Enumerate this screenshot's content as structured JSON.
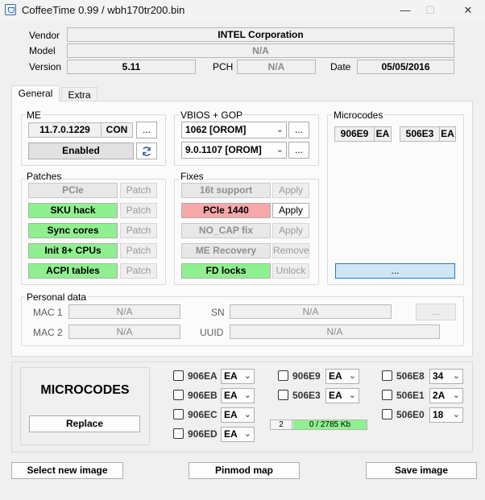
{
  "window": {
    "title": "CoffeeTime 0.99  /  wbh170tr200.bin",
    "minimize_glyph": "—",
    "maximize_glyph": "☐",
    "close_glyph": "✕"
  },
  "info": {
    "vendor_label": "Vendor",
    "vendor_value": "INTEL Corporation",
    "model_label": "Model",
    "model_value": "N/A",
    "version_label": "Version",
    "version_value": "5.11",
    "pch_label": "PCH",
    "pch_value": "N/A",
    "date_label": "Date",
    "date_value": "05/05/2016"
  },
  "tabs": [
    {
      "label": "General"
    },
    {
      "label": "Extra"
    }
  ],
  "me": {
    "title": "ME",
    "version": "11.7.0.1229",
    "type": "CON",
    "more": "...",
    "state": "Enabled",
    "refresh_icon": "refresh-icon"
  },
  "vbios": {
    "title": "VBIOS + GOP",
    "vbios_value": "1062 [OROM]",
    "gop_value": "9.0.1107 [OROM]",
    "more": "..."
  },
  "microcodes_panel": {
    "title": "Microcodes",
    "items": [
      {
        "cpuid": "906E9",
        "tag": "EA"
      },
      {
        "cpuid": "506E3",
        "tag": "EA"
      }
    ],
    "more": "..."
  },
  "patches": {
    "title": "Patches",
    "items": [
      {
        "label": "PCIe",
        "action": "Patch",
        "state": "off"
      },
      {
        "label": "SKU hack",
        "action": "Patch",
        "state": "green"
      },
      {
        "label": "Sync cores",
        "action": "Patch",
        "state": "green"
      },
      {
        "label": "Init 8+ CPUs",
        "action": "Patch",
        "state": "green"
      },
      {
        "label": "ACPI tables",
        "action": "Patch",
        "state": "green"
      }
    ]
  },
  "fixes": {
    "title": "Fixes",
    "items": [
      {
        "label": "16t support",
        "action": "Apply",
        "state": "off"
      },
      {
        "label": "PCIe 1440",
        "action": "Apply",
        "state": "red"
      },
      {
        "label": "NO_CAP fix",
        "action": "Apply",
        "state": "off"
      },
      {
        "label": "ME Recovery",
        "action": "Remove",
        "state": "off"
      },
      {
        "label": "FD locks",
        "action": "Unlock",
        "state": "green"
      }
    ]
  },
  "personal": {
    "title": "Personal data",
    "mac1_label": "MAC 1",
    "mac1_value": "N/A",
    "mac2_label": "MAC 2",
    "mac2_value": "N/A",
    "sn_label": "SN",
    "sn_value": "N/A",
    "uuid_label": "UUID",
    "uuid_value": "N/A",
    "more": "..."
  },
  "bottom": {
    "heading": "MICROCODES",
    "replace": "Replace",
    "col1": [
      {
        "cpuid": "906EA",
        "value": "EA"
      },
      {
        "cpuid": "906EB",
        "value": "EA"
      },
      {
        "cpuid": "906EC",
        "value": "EA"
      },
      {
        "cpuid": "906ED",
        "value": "EA"
      }
    ],
    "col2": [
      {
        "cpuid": "906E9",
        "value": "EA"
      },
      {
        "cpuid": "506E3",
        "value": "EA"
      }
    ],
    "col3": [
      {
        "cpuid": "506E8",
        "value": "34"
      },
      {
        "cpuid": "506E1",
        "value": "2A"
      },
      {
        "cpuid": "506E0",
        "value": "18"
      }
    ],
    "count": "2",
    "usage": "0 / 2785 Kb"
  },
  "footer": {
    "select_image": "Select new image",
    "pinmod_map": "Pinmod map",
    "save_image": "Save image"
  }
}
